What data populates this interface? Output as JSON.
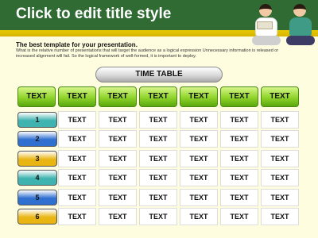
{
  "slide": {
    "title": "Click to edit title style",
    "subtitle": "The best template for your presentation.",
    "description": "What is the relative number of presentations that will target the audience as a logical expression Unnecessary information is released or increased alignment will fail. So the logical framework of well-formed, it is important to deploy."
  },
  "timetable": {
    "label": "TIME TABLE",
    "header": [
      "TEXT",
      "TEXT",
      "TEXT",
      "TEXT",
      "TEXT",
      "TEXT",
      "TEXT"
    ],
    "rows": [
      {
        "num": "1",
        "color": "#3fb3b0",
        "cells": [
          "TEXT",
          "TEXT",
          "TEXT",
          "TEXT",
          "TEXT",
          "TEXT"
        ]
      },
      {
        "num": "2",
        "color": "#2f6fd0",
        "cells": [
          "TEXT",
          "TEXT",
          "TEXT",
          "TEXT",
          "TEXT",
          "TEXT"
        ]
      },
      {
        "num": "3",
        "color": "#e8b512",
        "cells": [
          "TEXT",
          "TEXT",
          "TEXT",
          "TEXT",
          "TEXT",
          "TEXT"
        ]
      },
      {
        "num": "4",
        "color": "#3fb3b0",
        "cells": [
          "TEXT",
          "TEXT",
          "TEXT",
          "TEXT",
          "TEXT",
          "TEXT"
        ]
      },
      {
        "num": "5",
        "color": "#2f6fd0",
        "cells": [
          "TEXT",
          "TEXT",
          "TEXT",
          "TEXT",
          "TEXT",
          "TEXT"
        ]
      },
      {
        "num": "6",
        "color": "#e8b512",
        "cells": [
          "TEXT",
          "TEXT",
          "TEXT",
          "TEXT",
          "TEXT",
          "TEXT"
        ]
      }
    ]
  }
}
